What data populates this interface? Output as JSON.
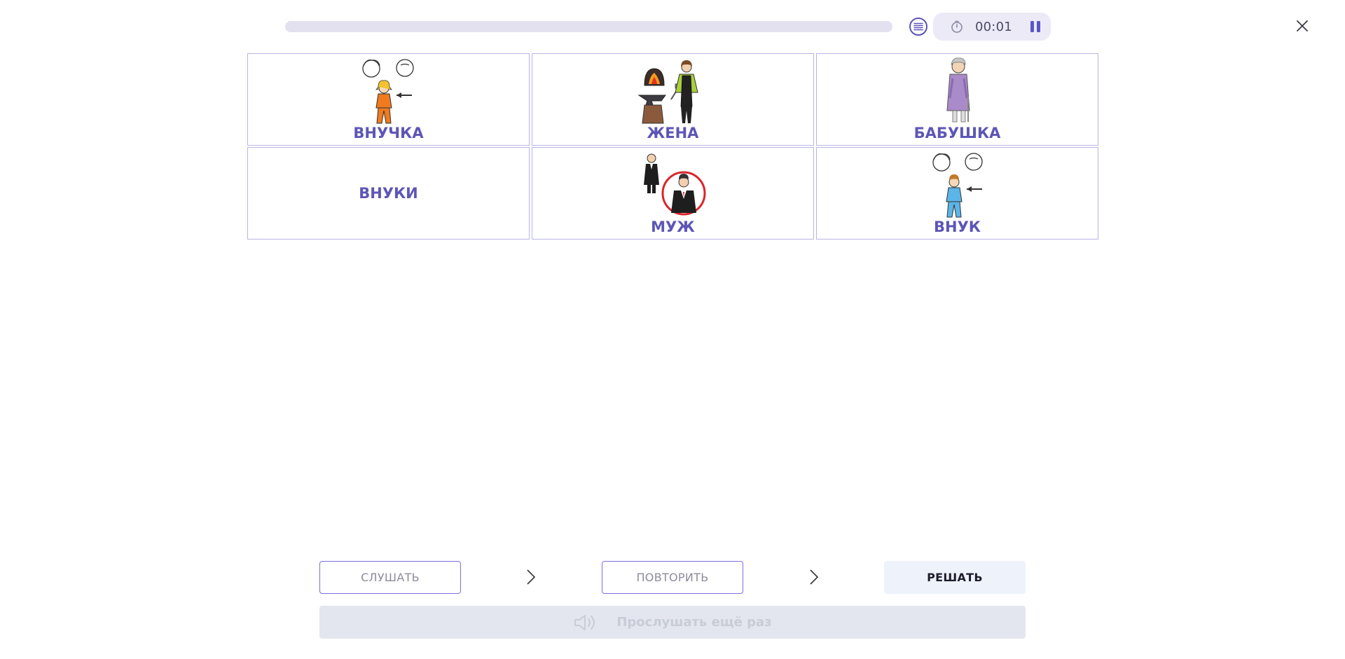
{
  "header": {
    "progress": 0,
    "timer": "00:01"
  },
  "cards": [
    {
      "label": "ВНУЧКА",
      "icon": "granddaughter-pictogram"
    },
    {
      "label": "ЖЕНА",
      "icon": "wife-blacksmith-pictogram"
    },
    {
      "label": "БАБУШКА",
      "icon": "grandmother-pictogram"
    },
    {
      "label": "ВНУКИ",
      "icon": ""
    },
    {
      "label": "МУЖ",
      "icon": "husband-pictogram"
    },
    {
      "label": "ВНУК",
      "icon": "grandson-pictogram"
    }
  ],
  "controls": {
    "listen_label": "СЛУШАТЬ",
    "repeat_label": "ПОВТОРИТЬ",
    "solve_label": "РЕШАТЬ",
    "listen_again_label": "Прослушать ещё раз"
  },
  "colors": {
    "accent": "#5d56b6",
    "card_border": "#b9b5e4",
    "button_border": "#7c6fe0",
    "disabled_bg": "#e3e6ee",
    "red_circle": "#d9262c"
  }
}
